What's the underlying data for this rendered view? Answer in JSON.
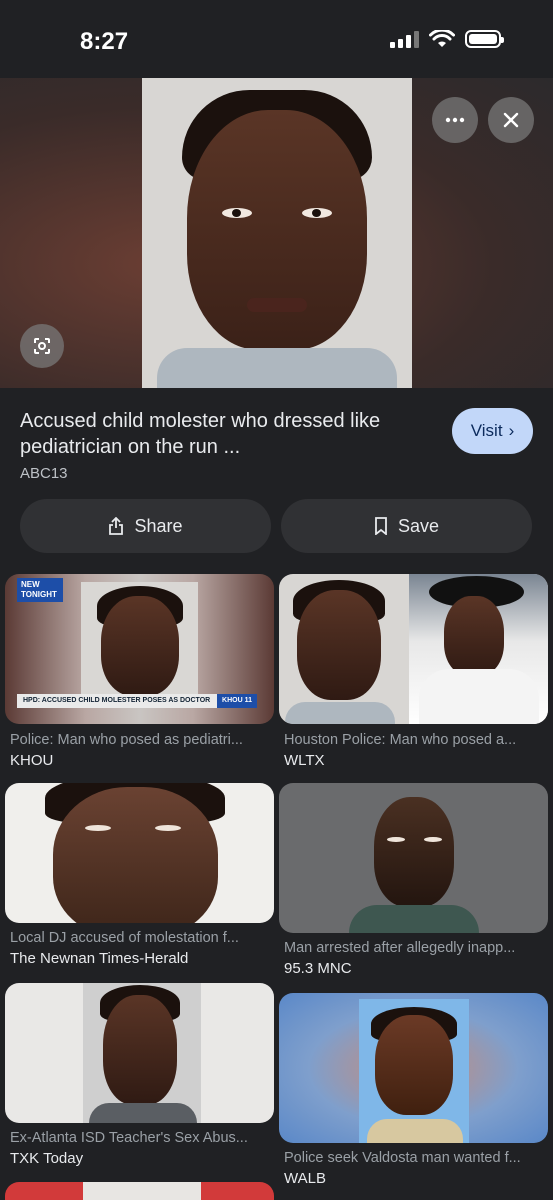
{
  "status": {
    "time": "8:27"
  },
  "hero": {
    "more_icon": "ellipsis-icon",
    "close_icon": "close-icon",
    "lens_icon": "lens-icon"
  },
  "result": {
    "title": "Accused child molester who dressed like pediatrician on the run ...",
    "source": "ABC13",
    "visit_label": "Visit"
  },
  "actions": {
    "share_label": "Share",
    "save_label": "Save"
  },
  "related": [
    {
      "caption": "Police: Man who posed as pediatri...",
      "source": "KHOU",
      "badge": "NEW TONIGHT",
      "lower_third": "HPD: ACCUSED CHILD MOLESTER POSES AS DOCTOR",
      "lower_tag": "KHOU 11"
    },
    {
      "caption": "Houston Police: Man who posed a...",
      "source": "WLTX"
    },
    {
      "caption": "Local DJ accused of molestation f...",
      "source": "The Newnan Times-Herald"
    },
    {
      "caption": "Man arrested after allegedly inapp...",
      "source": "95.3 MNC"
    },
    {
      "caption": "Ex-Atlanta ISD Teacher's Sex Abus...",
      "source": "TXK Today"
    },
    {
      "caption": "Police seek Valdosta man wanted f...",
      "source": "WALB"
    }
  ]
}
